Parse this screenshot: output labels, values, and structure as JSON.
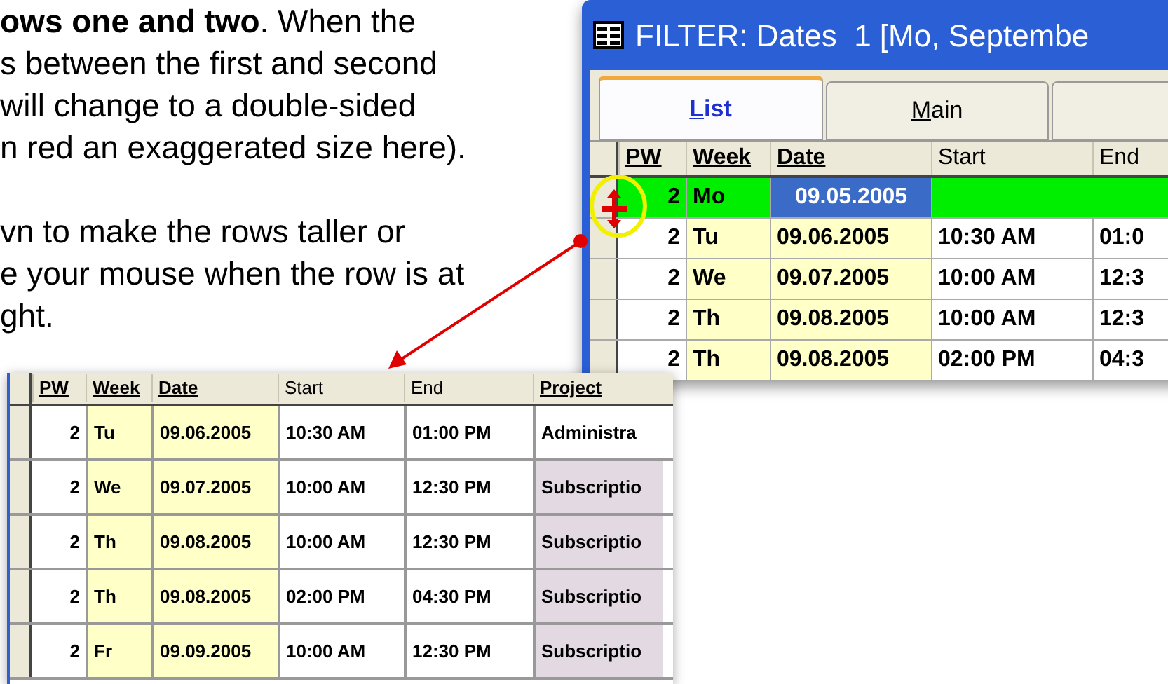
{
  "instructions": {
    "paragraphs": [
      {
        "lines": [
          "**ows one and two**. When the",
          "s between the first and second",
          "will change to a double-sided",
          "n red an exaggerated size here)."
        ]
      },
      {
        "lines": [
          "vn to make the rows taller or",
          "e your mouse when the row is at",
          "ght."
        ]
      }
    ]
  },
  "small_window": {
    "title": "FILTER: Dates  1 [Mo, Septembe",
    "tabs": [
      {
        "label": "List",
        "selected": true
      },
      {
        "label": "Main",
        "selected": false
      }
    ],
    "columns": [
      {
        "label": "PW",
        "underlined": true
      },
      {
        "label": "Week",
        "underlined": true
      },
      {
        "label": "Date",
        "underlined": true
      },
      {
        "label": "Start",
        "underlined": false
      },
      {
        "label": "End",
        "underlined": false
      }
    ],
    "rows": [
      {
        "pw": "2",
        "week": "Mo",
        "date": "09.05.2005",
        "selected": true
      },
      {
        "pw": "2",
        "week": "Tu",
        "date": "09.06.2005",
        "start": "10:30 AM",
        "end": "01:0",
        "selected": false
      },
      {
        "pw": "2",
        "week": "We",
        "date": "09.07.2005",
        "start": "10:00 AM",
        "end": "12:3",
        "selected": false
      },
      {
        "pw": "2",
        "week": "Th",
        "date": "09.08.2005",
        "start": "10:00 AM",
        "end": "12:3",
        "selected": false
      },
      {
        "pw": "2",
        "week": "Th",
        "date": "09.08.2005",
        "start": "02:00 PM",
        "end": "04:3",
        "selected": false
      }
    ]
  },
  "large_table": {
    "columns": [
      {
        "label": "PW",
        "underlined": true
      },
      {
        "label": "Week",
        "underlined": true
      },
      {
        "label": "Date",
        "underlined": true
      },
      {
        "label": "Start",
        "underlined": false
      },
      {
        "label": "End",
        "underlined": false
      },
      {
        "label": "Project",
        "underlined": true
      }
    ],
    "rows": [
      {
        "pw": "2",
        "week": "Tu",
        "date": "09.06.2005",
        "start": "10:30 AM",
        "end": "01:00 PM",
        "project": {
          "text": "Administra",
          "color": "#ffffff"
        }
      },
      {
        "pw": "2",
        "week": "We",
        "date": "09.07.2005",
        "start": "10:00 AM",
        "end": "12:30 PM",
        "project": {
          "text": "Subscriptio",
          "color": "#e2d9e2"
        }
      },
      {
        "pw": "2",
        "week": "Th",
        "date": "09.08.2005",
        "start": "10:00 AM",
        "end": "12:30 PM",
        "project": {
          "text": "Subscriptio",
          "color": "#e2d9e2"
        }
      },
      {
        "pw": "2",
        "week": "Th",
        "date": "09.08.2005",
        "start": "02:00 PM",
        "end": "04:30 PM",
        "project": {
          "text": "Subscriptio",
          "color": "#e2d9e2"
        }
      },
      {
        "pw": "2",
        "week": "Fr",
        "date": "09.09.2005",
        "start": "10:00 AM",
        "end": "12:30 PM",
        "project": {
          "text": "Subscriptio",
          "color": "#e2d9e2"
        }
      }
    ]
  }
}
